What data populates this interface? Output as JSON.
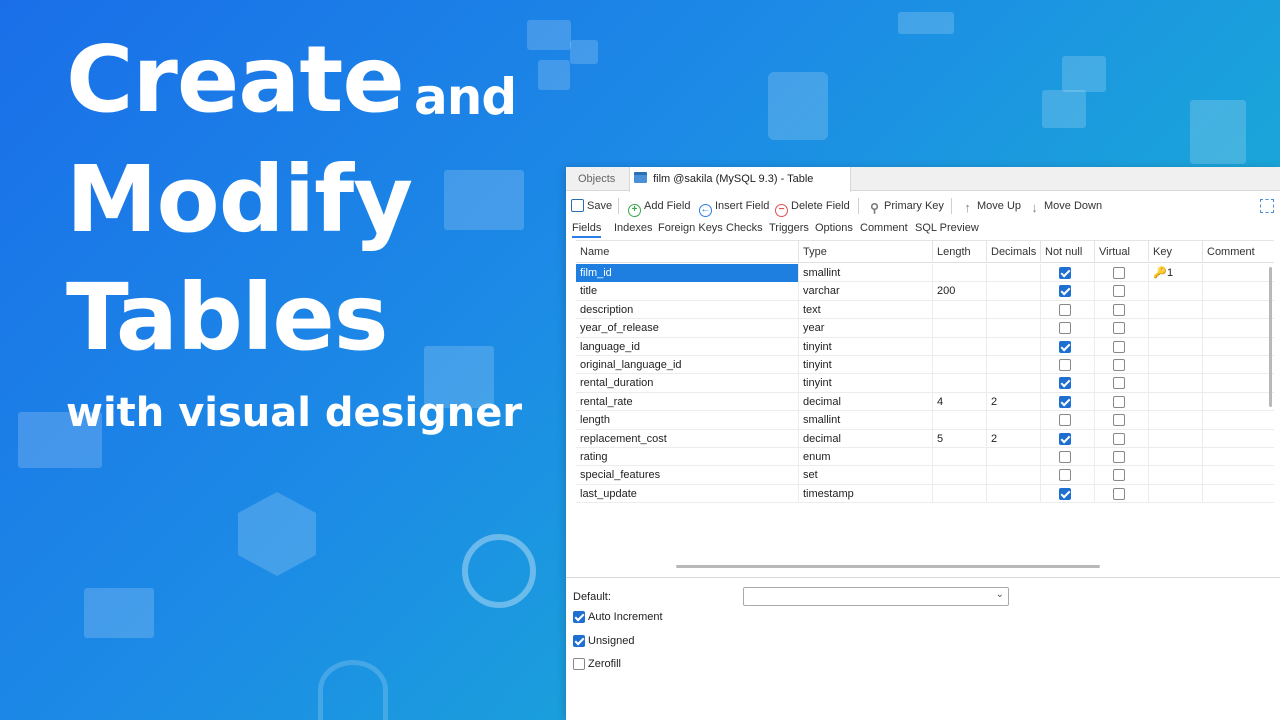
{
  "hero": {
    "line1": "Create",
    "line1_small": "and",
    "line2": "Modify",
    "line3": "Tables",
    "line4": "with visual designer"
  },
  "window": {
    "tabs": [
      {
        "label": "Objects",
        "active": false
      },
      {
        "label": "film @sakila (MySQL 9.3) - Table",
        "active": true
      }
    ],
    "toolbar": {
      "save": "Save",
      "add_field": "Add Field",
      "insert_field": "Insert Field",
      "delete_field": "Delete Field",
      "primary_key": "Primary Key",
      "move_up": "Move Up",
      "move_down": "Move Down"
    },
    "subtabs": [
      "Fields",
      "Indexes",
      "Foreign Keys",
      "Checks",
      "Triggers",
      "Options",
      "Comment",
      "SQL Preview"
    ],
    "columns": [
      "Name",
      "Type",
      "Length",
      "Decimals",
      "Not null",
      "Virtual",
      "Key",
      "Comment"
    ],
    "rows": [
      {
        "name": "film_id",
        "type": "smallint",
        "length": "",
        "decimals": "",
        "not_null": true,
        "virtual": false,
        "key": "1",
        "comment": "",
        "selected": true
      },
      {
        "name": "title",
        "type": "varchar",
        "length": "200",
        "decimals": "",
        "not_null": true,
        "virtual": false,
        "key": "",
        "comment": ""
      },
      {
        "name": "description",
        "type": "text",
        "length": "",
        "decimals": "",
        "not_null": false,
        "virtual": false,
        "key": "",
        "comment": ""
      },
      {
        "name": "year_of_release",
        "type": "year",
        "length": "",
        "decimals": "",
        "not_null": false,
        "virtual": false,
        "key": "",
        "comment": ""
      },
      {
        "name": "language_id",
        "type": "tinyint",
        "length": "",
        "decimals": "",
        "not_null": true,
        "virtual": false,
        "key": "",
        "comment": ""
      },
      {
        "name": "original_language_id",
        "type": "tinyint",
        "length": "",
        "decimals": "",
        "not_null": false,
        "virtual": false,
        "key": "",
        "comment": ""
      },
      {
        "name": "rental_duration",
        "type": "tinyint",
        "length": "",
        "decimals": "",
        "not_null": true,
        "virtual": false,
        "key": "",
        "comment": ""
      },
      {
        "name": "rental_rate",
        "type": "decimal",
        "length": "4",
        "decimals": "2",
        "not_null": true,
        "virtual": false,
        "key": "",
        "comment": ""
      },
      {
        "name": "length",
        "type": "smallint",
        "length": "",
        "decimals": "",
        "not_null": false,
        "virtual": false,
        "key": "",
        "comment": ""
      },
      {
        "name": "replacement_cost",
        "type": "decimal",
        "length": "5",
        "decimals": "2",
        "not_null": true,
        "virtual": false,
        "key": "",
        "comment": ""
      },
      {
        "name": "rating",
        "type": "enum",
        "length": "",
        "decimals": "",
        "not_null": false,
        "virtual": false,
        "key": "",
        "comment": ""
      },
      {
        "name": "special_features",
        "type": "set",
        "length": "",
        "decimals": "",
        "not_null": false,
        "virtual": false,
        "key": "",
        "comment": ""
      },
      {
        "name": "last_update",
        "type": "timestamp",
        "length": "",
        "decimals": "",
        "not_null": true,
        "virtual": false,
        "key": "",
        "comment": ""
      }
    ],
    "properties": {
      "default_label": "Default:",
      "default_value": "",
      "auto_increment": {
        "label": "Auto Increment",
        "checked": true
      },
      "unsigned": {
        "label": "Unsigned",
        "checked": true
      },
      "zerofill": {
        "label": "Zerofill",
        "checked": false
      }
    }
  },
  "colors": {
    "accent": "#1e7fe0",
    "key_icon": "#e0a010",
    "bg_start": "#1a6fe8",
    "bg_end": "#10b8c4"
  }
}
